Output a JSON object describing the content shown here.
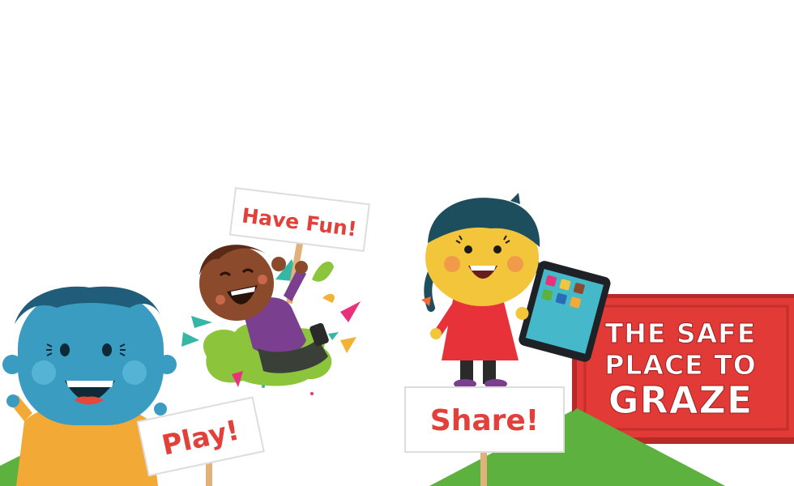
{
  "signs": {
    "have_fun": "Have Fun!",
    "play": "Play!",
    "share": "Share!"
  },
  "banner": {
    "line1": "THE SAFE",
    "line2": "PLACE TO",
    "line3": "GRAZE"
  },
  "colors": {
    "sign_text": "#e2403a",
    "banner_red": "#e23a36",
    "hill_green": "#5cb13f"
  }
}
